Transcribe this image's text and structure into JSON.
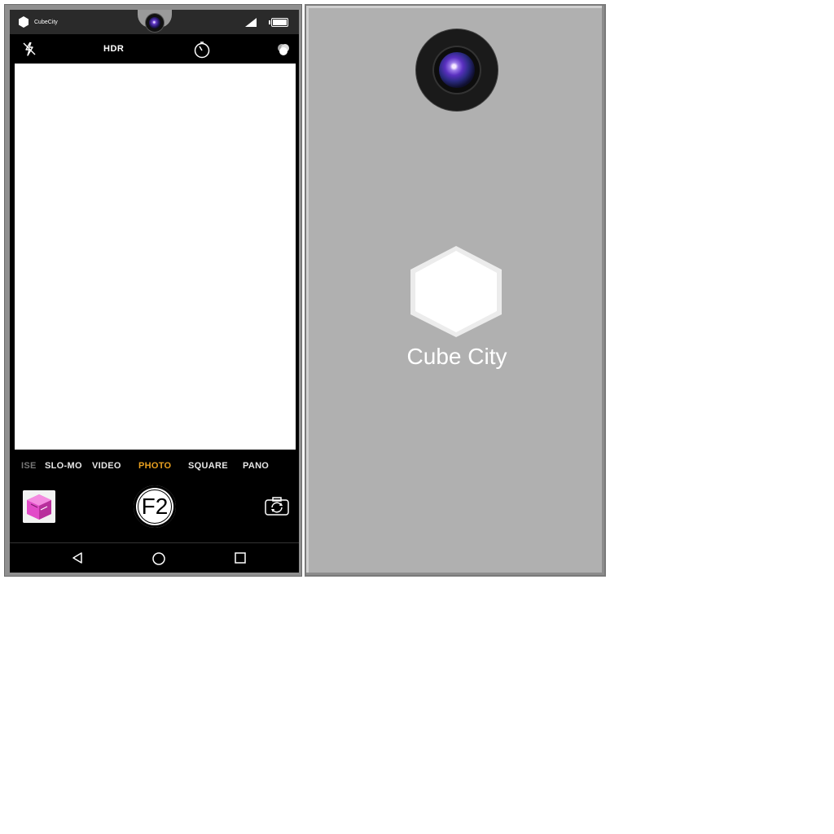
{
  "status_bar": {
    "brand": "CubeCity"
  },
  "camera_controls": {
    "hdr_label": "HDR",
    "flash_icon": "flash-off-icon",
    "timer_icon": "timer-icon",
    "filters_icon": "filters-icon"
  },
  "modes": {
    "items": [
      "ISE",
      "SLO-MO",
      "VIDEO",
      "PHOTO",
      "SQUARE",
      "PANO"
    ],
    "active": "PHOTO"
  },
  "shutter": {
    "label": "F2"
  },
  "nav": {
    "back_icon": "back-triangle-icon",
    "home_icon": "home-circle-icon",
    "recents_icon": "recents-square-icon"
  },
  "phone_back": {
    "brand_name": "Cube City"
  },
  "colors": {
    "active_mode": "#e8a020",
    "back_panel": "#b0b0b0"
  }
}
